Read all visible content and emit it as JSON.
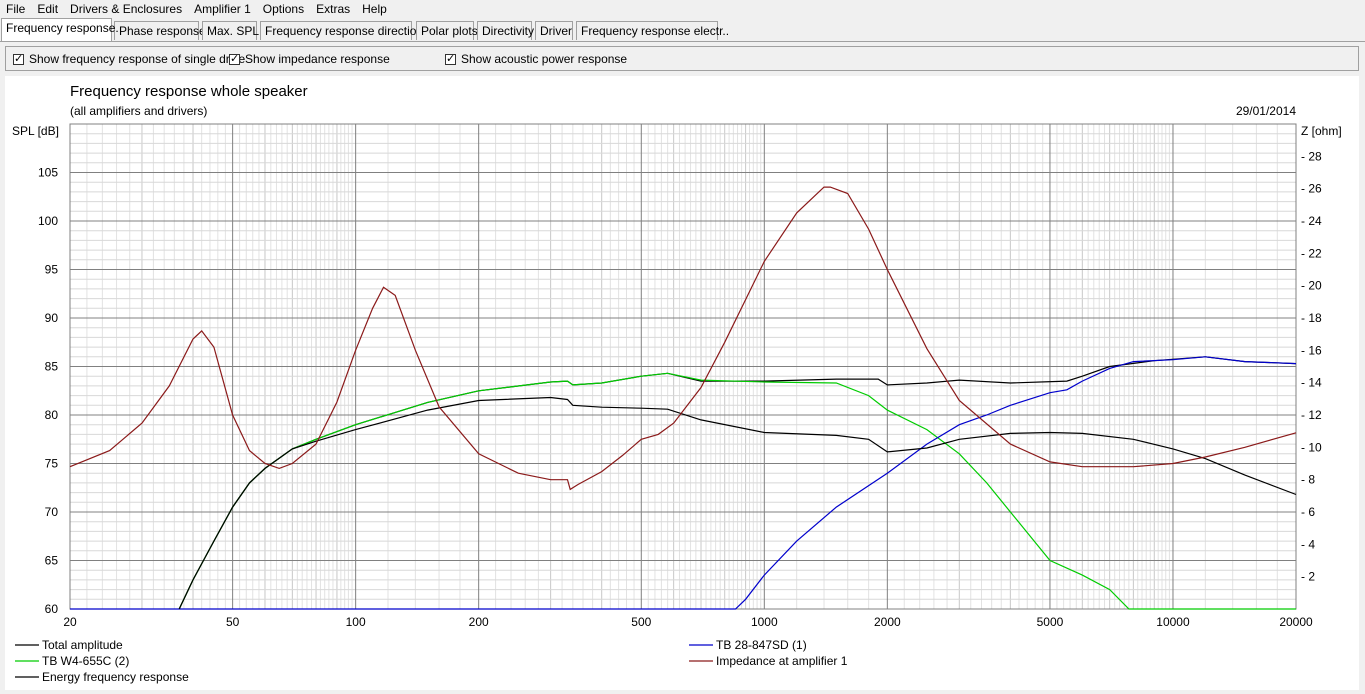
{
  "menu": [
    "File",
    "Edit",
    "Drivers & Enclosures",
    "Amplifier 1",
    "Options",
    "Extras",
    "Help"
  ],
  "tabs": [
    "Frequency response.",
    "Phase response",
    "Max. SPL",
    "Frequency response directions",
    "Polar plots",
    "Directivity",
    "Driver",
    "Frequency response electr.."
  ],
  "options": {
    "single_drive": "Show frequency response of single drive",
    "impedance": "Show impedance response",
    "acoustic_power": "Show acoustic power response"
  },
  "chart_data": {
    "type": "line",
    "title": "Frequency response whole speaker",
    "subtitle": "(all amplifiers and drivers)",
    "date": "29/01/2014",
    "ylabel": "SPL [dB]",
    "y2label": "Z [ohm]",
    "xscale": "log",
    "xlim": [
      20,
      20000
    ],
    "ylim": [
      60,
      110
    ],
    "y2lim": [
      0,
      30
    ],
    "xticks": [
      20,
      50,
      100,
      200,
      500,
      1000,
      2000,
      5000,
      10000,
      20000
    ],
    "yticks": [
      60,
      65,
      70,
      75,
      80,
      85,
      90,
      95,
      100,
      105
    ],
    "y2ticks": [
      2,
      4,
      6,
      8,
      10,
      12,
      14,
      16,
      18,
      20,
      22,
      24,
      26,
      28
    ],
    "grid": true,
    "series": [
      {
        "name": "Total amplitude",
        "color": "#000000",
        "axis": "left",
        "x": [
          37,
          40,
          45,
          50,
          55,
          60,
          70,
          80,
          100,
          150,
          200,
          300,
          330,
          340,
          400,
          500,
          580,
          700,
          1000,
          1500,
          1900,
          2000,
          2500,
          3000,
          4000,
          5500,
          6000,
          7000,
          9000,
          12000,
          15000,
          20000
        ],
        "y": [
          60,
          63,
          67,
          70.5,
          73,
          74.5,
          76.5,
          77.5,
          79,
          81.3,
          82.5,
          83.4,
          83.5,
          83.1,
          83.3,
          84,
          84.3,
          83.5,
          83.5,
          83.7,
          83.7,
          83.1,
          83.3,
          83.6,
          83.3,
          83.5,
          84,
          85,
          85.6,
          86,
          85.5,
          85.3
        ]
      },
      {
        "name": "TB W4-655C (2)",
        "color": "#00cc00",
        "axis": "left",
        "x": [
          37,
          40,
          45,
          50,
          55,
          60,
          70,
          80,
          100,
          150,
          200,
          300,
          330,
          340,
          400,
          500,
          580,
          700,
          1000,
          1500,
          1800,
          2000,
          2500,
          3000,
          3500,
          4000,
          5000,
          6000,
          7000,
          7800,
          8000,
          20000
        ],
        "y": [
          60,
          63,
          67,
          70.5,
          73,
          74.5,
          76.5,
          77.5,
          79,
          81.3,
          82.5,
          83.4,
          83.5,
          83.1,
          83.3,
          84,
          84.3,
          83.6,
          83.4,
          83.3,
          82,
          80.5,
          78.5,
          76,
          73,
          70,
          65,
          63.5,
          62,
          60,
          60,
          60
        ]
      },
      {
        "name": "TB 28-847SD (1)",
        "color": "#0000cc",
        "axis": "left",
        "x": [
          20,
          850,
          900,
          1000,
          1200,
          1500,
          2000,
          2500,
          3000,
          3500,
          4000,
          5000,
          5500,
          6000,
          7000,
          8000,
          10000,
          12000,
          15000,
          20000
        ],
        "y": [
          60,
          60,
          61,
          63.5,
          67,
          70.5,
          74,
          77,
          79,
          80,
          81,
          82.3,
          82.6,
          83.5,
          84.8,
          85.5,
          85.7,
          86,
          85.5,
          85.3
        ]
      },
      {
        "name": "Energy frequency response",
        "color": "#000000",
        "axis": "left",
        "x": [
          37,
          40,
          45,
          50,
          55,
          60,
          70,
          80,
          100,
          150,
          200,
          300,
          330,
          340,
          400,
          500,
          580,
          700,
          1000,
          1500,
          1800,
          2000,
          2500,
          3000,
          4000,
          5000,
          6000,
          8000,
          10000,
          12000,
          15000,
          20000
        ],
        "y": [
          60,
          63,
          67,
          70.5,
          73,
          74.5,
          76.5,
          77.3,
          78.5,
          80.5,
          81.5,
          81.8,
          81.6,
          81,
          80.8,
          80.7,
          80.6,
          79.5,
          78.2,
          77.9,
          77.5,
          76.2,
          76.6,
          77.5,
          78.1,
          78.2,
          78.1,
          77.5,
          76.5,
          75.5,
          73.8,
          71.8
        ]
      },
      {
        "name": "Impedance at amplifier 1",
        "color": "#8b1a1a",
        "axis": "right",
        "x": [
          20,
          25,
          30,
          35,
          40,
          42,
          45,
          50,
          55,
          60,
          65,
          70,
          80,
          90,
          100,
          110,
          117,
          125,
          140,
          160,
          200,
          250,
          300,
          330,
          335,
          350,
          400,
          450,
          500,
          550,
          600,
          700,
          800,
          1000,
          1200,
          1400,
          1450,
          1600,
          1800,
          2000,
          2500,
          3000,
          4000,
          5000,
          6000,
          7000,
          8000,
          10000,
          12000,
          15000,
          20000
        ],
        "y": [
          8.8,
          9.8,
          11.5,
          13.8,
          16.7,
          17.2,
          16.2,
          12,
          9.8,
          9,
          8.7,
          9,
          10.2,
          12.8,
          16,
          18.6,
          19.9,
          19.4,
          16,
          12.5,
          9.6,
          8.4,
          8,
          8,
          7.4,
          7.7,
          8.5,
          9.5,
          10.5,
          10.8,
          11.5,
          13.7,
          16.5,
          21.5,
          24.5,
          26.1,
          26.1,
          25.7,
          23.5,
          21,
          16.1,
          12.9,
          10.2,
          9.1,
          8.8,
          8.8,
          8.8,
          9,
          9.4,
          10,
          10.9
        ]
      }
    ],
    "legend": {
      "left": [
        "Total amplitude",
        "TB W4-655C (2)",
        "Energy frequency response"
      ],
      "right": [
        "TB 28-847SD (1)",
        "Impedance at amplifier 1"
      ]
    }
  }
}
